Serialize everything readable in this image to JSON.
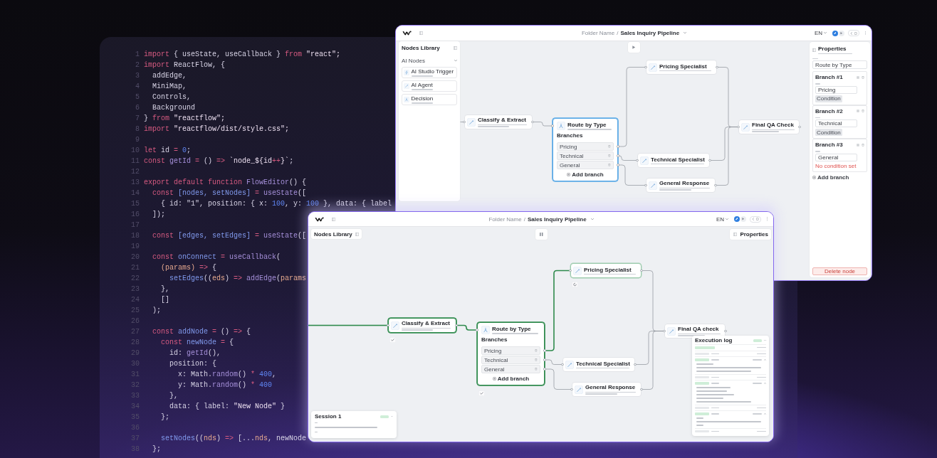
{
  "editor": {
    "lines": [
      {
        "number": "1",
        "tokens": [
          {
            "text": "import",
            "kind": "keyword"
          },
          {
            "text": " { useState, useCallback } ",
            "kind": "plain"
          },
          {
            "text": "from",
            "kind": "keyword"
          },
          {
            "text": " \"react\";",
            "kind": "string"
          }
        ]
      },
      {
        "number": "2",
        "tokens": [
          {
            "text": "import",
            "kind": "keyword"
          },
          {
            "text": " ReactFlow, {",
            "kind": "plain"
          }
        ]
      },
      {
        "number": "3",
        "tokens": [
          {
            "text": "  addEdge,",
            "kind": "plain"
          }
        ]
      },
      {
        "number": "4",
        "tokens": [
          {
            "text": "  MiniMap,",
            "kind": "plain"
          }
        ]
      },
      {
        "number": "5",
        "tokens": [
          {
            "text": "  Controls,",
            "kind": "plain"
          }
        ]
      },
      {
        "number": "6",
        "tokens": [
          {
            "text": "  Background",
            "kind": "plain"
          }
        ]
      },
      {
        "number": "7",
        "tokens": [
          {
            "text": "} ",
            "kind": "plain"
          },
          {
            "text": "from",
            "kind": "keyword"
          },
          {
            "text": " \"reactflow\";",
            "kind": "string"
          }
        ]
      },
      {
        "number": "8",
        "tokens": [
          {
            "text": "import",
            "kind": "keyword"
          },
          {
            "text": " \"reactflow/dist/style.css\";",
            "kind": "string"
          }
        ]
      },
      {
        "number": "9"
      },
      {
        "number": "10",
        "tokens": [
          {
            "text": "let",
            "kind": "keyword"
          },
          {
            "text": " id ",
            "kind": "plain"
          },
          {
            "text": "=",
            "kind": "keyword"
          },
          {
            "text": " 0",
            "kind": "number"
          },
          {
            "text": ";",
            "kind": "plain"
          }
        ]
      },
      {
        "number": "11",
        "tokens": [
          {
            "text": "const",
            "kind": "keyword"
          },
          {
            "text": " getId ",
            "kind": "function"
          },
          {
            "text": "=",
            "kind": "keyword"
          },
          {
            "text": " () ",
            "kind": "plain"
          },
          {
            "text": "=>",
            "kind": "keyword"
          },
          {
            "text": " `node_${id",
            "kind": "string"
          },
          {
            "text": "++",
            "kind": "keyword"
          },
          {
            "text": "}`",
            "kind": "string"
          },
          {
            "text": ";",
            "kind": "plain"
          }
        ]
      },
      {
        "number": "12"
      },
      {
        "number": "13",
        "tokens": [
          {
            "text": "export default function",
            "kind": "keyword"
          },
          {
            "text": " FlowEditor",
            "kind": "function"
          },
          {
            "text": "() {",
            "kind": "plain"
          }
        ]
      },
      {
        "number": "14",
        "tokens": [
          {
            "text": "  const",
            "kind": "keyword"
          },
          {
            "text": " [nodes, setNodes]",
            "kind": "variable"
          },
          {
            "text": " =",
            "kind": "keyword"
          },
          {
            "text": " useState",
            "kind": "function"
          },
          {
            "text": "([",
            "kind": "plain"
          }
        ]
      },
      {
        "number": "15",
        "tokens": [
          {
            "text": "    { id: \"1\", position: { x: ",
            "kind": "plain"
          },
          {
            "text": "100",
            "kind": "number"
          },
          {
            "text": ", y: ",
            "kind": "plain"
          },
          {
            "text": "100",
            "kind": "number"
          },
          {
            "text": " }, data: { label",
            "kind": "plain"
          }
        ]
      },
      {
        "number": "16",
        "tokens": [
          {
            "text": "  ]);",
            "kind": "plain"
          }
        ]
      },
      {
        "number": "17"
      },
      {
        "number": "18",
        "tokens": [
          {
            "text": "  const",
            "kind": "keyword"
          },
          {
            "text": " [edges, setEdges]",
            "kind": "variable"
          },
          {
            "text": " =",
            "kind": "keyword"
          },
          {
            "text": " useState",
            "kind": "function"
          },
          {
            "text": "([",
            "kind": "plain"
          }
        ]
      },
      {
        "number": "19"
      },
      {
        "number": "20",
        "tokens": [
          {
            "text": "  const",
            "kind": "keyword"
          },
          {
            "text": " onConnect",
            "kind": "variable"
          },
          {
            "text": " =",
            "kind": "keyword"
          },
          {
            "text": " useCallback",
            "kind": "function"
          },
          {
            "text": "(",
            "kind": "plain"
          }
        ]
      },
      {
        "number": "21",
        "tokens": [
          {
            "text": "    (params)",
            "kind": "parameter"
          },
          {
            "text": " =>",
            "kind": "keyword"
          },
          {
            "text": " {",
            "kind": "plain"
          }
        ]
      },
      {
        "number": "22",
        "tokens": [
          {
            "text": "      setEdges",
            "kind": "variable"
          },
          {
            "text": "((",
            "kind": "plain"
          },
          {
            "text": "eds",
            "kind": "parameter"
          },
          {
            "text": ") ",
            "kind": "plain"
          },
          {
            "text": "=>",
            "kind": "keyword"
          },
          {
            "text": " addEdge",
            "kind": "function"
          },
          {
            "text": "(",
            "kind": "plain"
          },
          {
            "text": "params",
            "kind": "parameter"
          }
        ]
      },
      {
        "number": "23",
        "tokens": [
          {
            "text": "    },",
            "kind": "plain"
          }
        ]
      },
      {
        "number": "24",
        "tokens": [
          {
            "text": "    []",
            "kind": "plain"
          }
        ]
      },
      {
        "number": "25",
        "tokens": [
          {
            "text": "  );",
            "kind": "plain"
          }
        ]
      },
      {
        "number": "26"
      },
      {
        "number": "27",
        "tokens": [
          {
            "text": "  const",
            "kind": "keyword"
          },
          {
            "text": " addNode",
            "kind": "variable"
          },
          {
            "text": " =",
            "kind": "keyword"
          },
          {
            "text": " () ",
            "kind": "plain"
          },
          {
            "text": "=>",
            "kind": "keyword"
          },
          {
            "text": " {",
            "kind": "plain"
          }
        ]
      },
      {
        "number": "28",
        "tokens": [
          {
            "text": "    const",
            "kind": "keyword"
          },
          {
            "text": " newNode",
            "kind": "variable"
          },
          {
            "text": " =",
            "kind": "keyword"
          },
          {
            "text": " {",
            "kind": "plain"
          }
        ]
      },
      {
        "number": "29",
        "tokens": [
          {
            "text": "      id: ",
            "kind": "plain"
          },
          {
            "text": "getId",
            "kind": "function"
          },
          {
            "text": "(),",
            "kind": "plain"
          }
        ]
      },
      {
        "number": "30",
        "tokens": [
          {
            "text": "      position: {",
            "kind": "plain"
          }
        ]
      },
      {
        "number": "31",
        "tokens": [
          {
            "text": "        x: Math.",
            "kind": "plain"
          },
          {
            "text": "random",
            "kind": "function"
          },
          {
            "text": "() ",
            "kind": "plain"
          },
          {
            "text": "*",
            "kind": "keyword"
          },
          {
            "text": " 400",
            "kind": "number"
          },
          {
            "text": ",",
            "kind": "plain"
          }
        ]
      },
      {
        "number": "32",
        "tokens": [
          {
            "text": "        y: Math.",
            "kind": "plain"
          },
          {
            "text": "random",
            "kind": "function"
          },
          {
            "text": "() ",
            "kind": "plain"
          },
          {
            "text": "*",
            "kind": "keyword"
          },
          {
            "text": " 400",
            "kind": "number"
          }
        ]
      },
      {
        "number": "33",
        "tokens": [
          {
            "text": "      },",
            "kind": "plain"
          }
        ]
      },
      {
        "number": "34",
        "tokens": [
          {
            "text": "      data: { label: ",
            "kind": "plain"
          },
          {
            "text": "\"New Node\"",
            "kind": "string"
          },
          {
            "text": " }",
            "kind": "plain"
          }
        ]
      },
      {
        "number": "35",
        "tokens": [
          {
            "text": "    };",
            "kind": "plain"
          }
        ]
      },
      {
        "number": "36"
      },
      {
        "number": "37",
        "tokens": [
          {
            "text": "    setNodes",
            "kind": "variable"
          },
          {
            "text": "((",
            "kind": "plain"
          },
          {
            "text": "nds",
            "kind": "parameter"
          },
          {
            "text": ") ",
            "kind": "plain"
          },
          {
            "text": "=>",
            "kind": "keyword"
          },
          {
            "text": " [...",
            "kind": "plain"
          },
          {
            "text": "nds",
            "kind": "parameter"
          },
          {
            "text": ", newNode",
            "kind": "plain"
          }
        ]
      },
      {
        "number": "38",
        "tokens": [
          {
            "text": "  };",
            "kind": "plain"
          }
        ]
      }
    ]
  },
  "windows": [
    {
      "breadcrumb": {
        "folder": "Folder Name",
        "separator": "/",
        "title": "Sales Inquiry Pipeline"
      },
      "language": "EN",
      "run_control": {
        "running": false
      },
      "nodes_library": {
        "title": "Nodes Library",
        "expanded": true,
        "section": {
          "title": "AI Nodes",
          "expanded": true,
          "items": [
            {
              "kind": "trigger",
              "title": "AI Studio Trigger"
            },
            {
              "kind": "agent",
              "title": "AI Agent"
            },
            {
              "kind": "decision",
              "title": "Decision"
            }
          ]
        }
      },
      "nodes": [
        {
          "kind": "agent",
          "title": "Classify & Extract",
          "selected": false,
          "completed": false,
          "running": false
        },
        {
          "kind": "decision",
          "title": "Route by Type",
          "selected": true,
          "completed": false,
          "running": false,
          "branches_label": "Branches",
          "branches": [
            "Pricing",
            "Technical",
            "General"
          ],
          "add_label": "Add branch"
        },
        {
          "kind": "agent",
          "title": "Pricing Specialist",
          "selected": false,
          "completed": false,
          "running": false
        },
        {
          "kind": "agent",
          "title": "Technical Specialist",
          "selected": false,
          "completed": false,
          "running": false
        },
        {
          "kind": "agent",
          "title": "General Response",
          "selected": false,
          "completed": false,
          "running": false
        },
        {
          "kind": "agent",
          "title": "Final QA Check",
          "selected": false,
          "completed": false,
          "running": false
        }
      ],
      "edges": [
        {
          "active": false
        },
        {
          "active": false
        },
        {
          "active": false
        },
        {
          "active": false
        },
        {
          "active": false
        },
        {
          "active": false
        },
        {
          "active": false
        },
        {
          "active": false
        }
      ],
      "properties": {
        "title": "Properties",
        "expanded": true,
        "title_value": "Route by Type",
        "branches": [
          {
            "name": "Branch #1",
            "value": "Pricing",
            "condition": {
              "kind": "button",
              "text": "Condition"
            }
          },
          {
            "name": "Branch #2",
            "value": "Technical",
            "condition": {
              "kind": "button",
              "text": "Condition"
            }
          },
          {
            "name": "Branch #3",
            "value": "General",
            "condition": {
              "kind": "warning",
              "text": "No condition set"
            }
          }
        ],
        "add_label": "Add branch",
        "delete_label": "Delete node"
      }
    },
    {
      "breadcrumb": {
        "folder": "Folder Name",
        "separator": "/",
        "title": "Sales Inquiry Pipeline"
      },
      "language": "EN",
      "run_control": {
        "running": true
      },
      "nodes_library": {
        "title": "Nodes Library",
        "expanded": false
      },
      "nodes": [
        {
          "kind": "agent",
          "title": "Classify & Extract",
          "selected": false,
          "completed": true,
          "running": false
        },
        {
          "kind": "decision",
          "title": "Route by Type",
          "selected": false,
          "completed": true,
          "running": false,
          "branches_label": "Branches",
          "branches": [
            "Pricing",
            "Technical",
            "General"
          ],
          "add_label": "Add branch"
        },
        {
          "kind": "agent",
          "title": "Pricing Specialist",
          "selected": false,
          "completed": false,
          "running": true
        },
        {
          "kind": "agent",
          "title": "Technical Specialist",
          "selected": false,
          "completed": false,
          "running": false
        },
        {
          "kind": "agent",
          "title": "General Response",
          "selected": false,
          "completed": false,
          "running": false
        },
        {
          "kind": "agent",
          "title": "Final QA check",
          "selected": false,
          "completed": false,
          "running": false
        }
      ],
      "edges": [
        {
          "active": true
        },
        {
          "active": true
        },
        {
          "active": true
        },
        {
          "active": false
        },
        {
          "active": false
        },
        {
          "active": false
        },
        {
          "active": false
        },
        {
          "active": false
        }
      ],
      "properties": {
        "title": "Properties",
        "expanded": false
      },
      "execution_log": {
        "title": "Execution log",
        "running": true,
        "entries": [
          {
            "kind": "workflow"
          },
          {
            "kind": "started"
          },
          {
            "kind": "completed",
            "expanded": true
          },
          {
            "kind": "started"
          },
          {
            "kind": "completed",
            "expanded": true
          },
          {
            "kind": "started"
          },
          {
            "kind": "completed",
            "expanded": true
          },
          {
            "kind": "started"
          }
        ]
      },
      "session": {
        "title": "Session 1",
        "completed": true,
        "expanded": true
      }
    }
  ]
}
